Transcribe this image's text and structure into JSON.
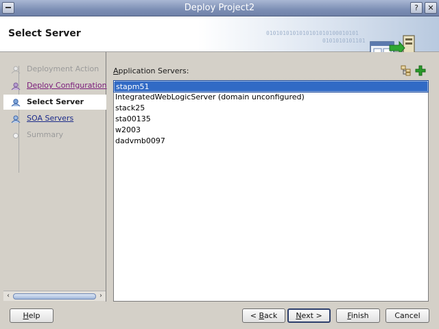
{
  "window": {
    "title": "Deploy Project2",
    "controls": {
      "help": "?",
      "close": "✕"
    }
  },
  "header": {
    "page_title": "Select Server",
    "binary_text_1": "0101010101010101010100010101",
    "binary_text_2": "0101010101101"
  },
  "steps": [
    {
      "label": "Deployment Action",
      "state": "disabled"
    },
    {
      "label": "Deploy Configuration",
      "state": "visited"
    },
    {
      "label": "Select Server",
      "state": "current"
    },
    {
      "label": "SOA Servers",
      "state": "link"
    },
    {
      "label": "Summary",
      "state": "disabled"
    }
  ],
  "content": {
    "list_label_mnemonic": "A",
    "list_label_rest": "pplication Servers:",
    "servers": [
      {
        "name": "stapm51",
        "selected": true
      },
      {
        "name": "IntegratedWebLogicServer (domain unconfigured)",
        "selected": false
      },
      {
        "name": "stack25",
        "selected": false
      },
      {
        "name": "sta00135",
        "selected": false
      },
      {
        "name": "w2003",
        "selected": false
      },
      {
        "name": "dadvmb0097",
        "selected": false
      }
    ]
  },
  "buttons": {
    "help": {
      "mnemonic": "H",
      "rest": "elp"
    },
    "back": {
      "prefix": "< ",
      "mnemonic": "B",
      "rest": "ack"
    },
    "next": {
      "mnemonic": "N",
      "rest": "ext >"
    },
    "finish": {
      "mnemonic": "F",
      "rest": "inish"
    },
    "cancel": {
      "label": "Cancel"
    }
  },
  "colors": {
    "selection": "#316ac5",
    "titlebar": "#7d8fb5",
    "add_icon": "#2a9a2a"
  }
}
